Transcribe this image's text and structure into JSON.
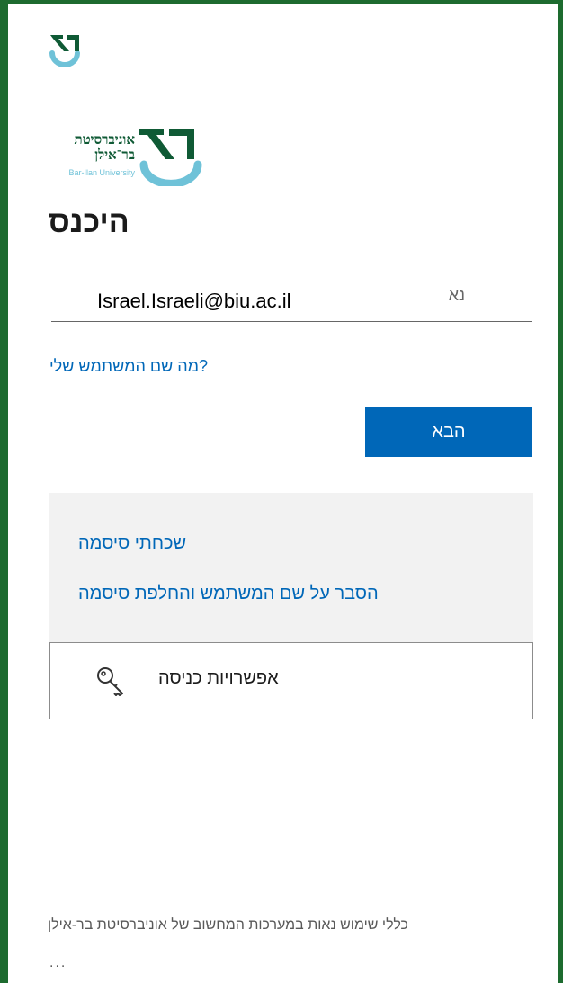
{
  "logo": {
    "small_icon": "bar-ilan-logo-icon",
    "brand_icon": "bar-ilan-logo",
    "brand_name_line1": "אוניברסיטת",
    "brand_name_line2": "בר־אילן",
    "brand_name_en": "Bar-Ilan University"
  },
  "signin": {
    "title": "היכנס",
    "email_value": "Israel.Israeli@biu.ac.il",
    "email_placeholder": "נא",
    "username_help_link": "?מה שם המשתמש שלי",
    "next_button": "הבא"
  },
  "help": {
    "forgot_password": "שכחתי סיסמה",
    "explain_username": "הסבר על שם המשתמש והחלפת סיסמה"
  },
  "options": {
    "label": "אפשרויות כניסה",
    "icon": "key-icon"
  },
  "footer": {
    "terms_link": "כללי שימוש נאות במערכות המחשוב של אוניברסיטת בר-אילן",
    "more": "..."
  },
  "colors": {
    "frame": "#1d6b2f",
    "accent": "#0067b8",
    "logo_green": "#0f5a35",
    "logo_teal": "#6fc2d8",
    "panel": "#f2f2f2"
  }
}
